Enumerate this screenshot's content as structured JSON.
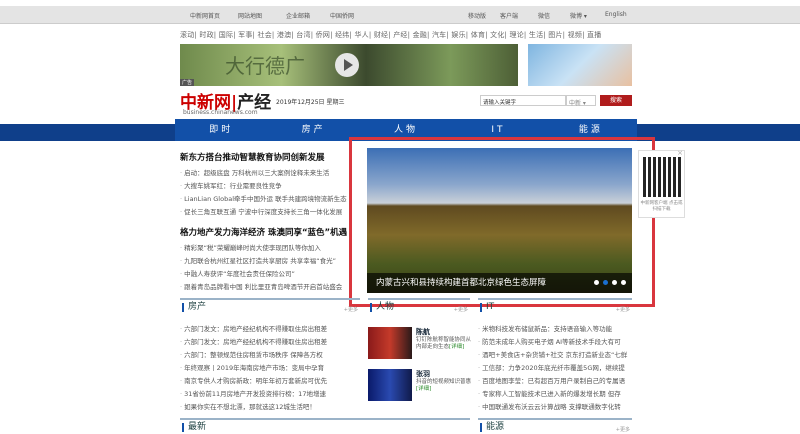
{
  "topbar": {
    "left": [
      "中新网首页",
      "网站地图",
      "企业邮箱",
      "中国侨网"
    ],
    "right": [
      "移动版",
      "客户端",
      "微信",
      "微博 ▾",
      "English"
    ]
  },
  "categories": "滚动| 时政| 国际| 军事| 社会| 港澳| 台湾| 侨网| 经纬| 华人| 财经| 产经| 金融| 汽车| 娱乐| 体育| 文化| 理论| 生活| 图片| 视频| 直播",
  "banner": {
    "text": "大行德广",
    "ad_label": "广告"
  },
  "logo": {
    "brand": "中新网",
    "section": "产经",
    "domain": "business.chinanews.com"
  },
  "date": "2019年12月25日 星期三",
  "search": {
    "placeholder": "请输入关键字",
    "scope": "中新 ▾",
    "button": "搜索"
  },
  "nav": [
    "即时",
    "房产",
    "人物",
    "IT",
    "能源"
  ],
  "headlines": [
    {
      "title": "新东方搭台推动智慧教育协同创新发展",
      "items": [
        "启动：超级底盘 万科杭州以三大案例诠释未来生活",
        "大搜车姚军红：行业需要良性竞争",
        "LianLian Global牵手中国外运 联手共建跨境物流新生态",
        "促长三角互联互通 宁波中行深度支持长三角一体化发展"
      ]
    },
    {
      "title": "格力地产发力海洋经济 珠澳同享“蓝色”机遇",
      "items": [
        "精彩聚“税”荣耀巅峰时尚大使李现团队等你加入",
        "九阳联合杭州红星社区打造共享厨房 共享幸福“食光”",
        "中融人寿获评“年度社会责任保险公司”",
        "跟着青岛品牌看中国 利比里亚青岛啤酒节开启首站盛会"
      ]
    }
  ],
  "slideshow": {
    "caption": "内蒙古兴和县持续构建首都北京绿色生态屏障",
    "slides": 4,
    "active": 2
  },
  "qr": {
    "text": "中新网客户端 点击或扫描下载"
  },
  "sections": {
    "more": "+更多",
    "fangchan": {
      "title": "房产",
      "items": [
        "六部门发文：房地产经纪机构不得赚取住房出租差",
        "六部门发文：房地产经纪机构不得赚取住房出租差",
        "六部门：整顿规范住房租赁市场秩序 保障各方权",
        "年终观察丨2019年海南房地产市场：变局中孕育",
        "南京专供人才购房新政：明年年初万套新房可优先",
        "31省份前11月房地产开发投资排行榜：17地增速",
        "如果你实在不想北漂，那就选这12城生活吧！"
      ]
    },
    "renwu": {
      "title": "人物",
      "people": [
        {
          "name": "陈航",
          "desc": "钉钉陈航称智能协同从内部走向生态",
          "link": "[详细]"
        },
        {
          "name": "张羽",
          "desc": "抖音的短视频知识普惠",
          "link": "[详细]"
        }
      ]
    },
    "it": {
      "title": "IT",
      "items": [
        "米物科技发布储鼠新品：支持语音输入等功能",
        "防范未成年人购买电子烟 AI等新技术手段大有可",
        "酒吧+美食店+杂货铺+社交 京东打造新业态“七鲜",
        "工信部：力争2020年底光纤市覆盖5G网，继续提",
        "百度地图李莹：已有超百万用户录制自己的专属语",
        "专家称人工智能技术已进入新的爆发增长期 但存",
        "中国联通发布沃云云计算战略 支撑联通数字化转"
      ]
    },
    "zuixin": {
      "title": "最新"
    },
    "nengyuan": {
      "title": "能源"
    }
  },
  "colors": {
    "nav": "#1250a8",
    "highlight_box": "#d9363e",
    "search_button": "#b01c1c"
  }
}
